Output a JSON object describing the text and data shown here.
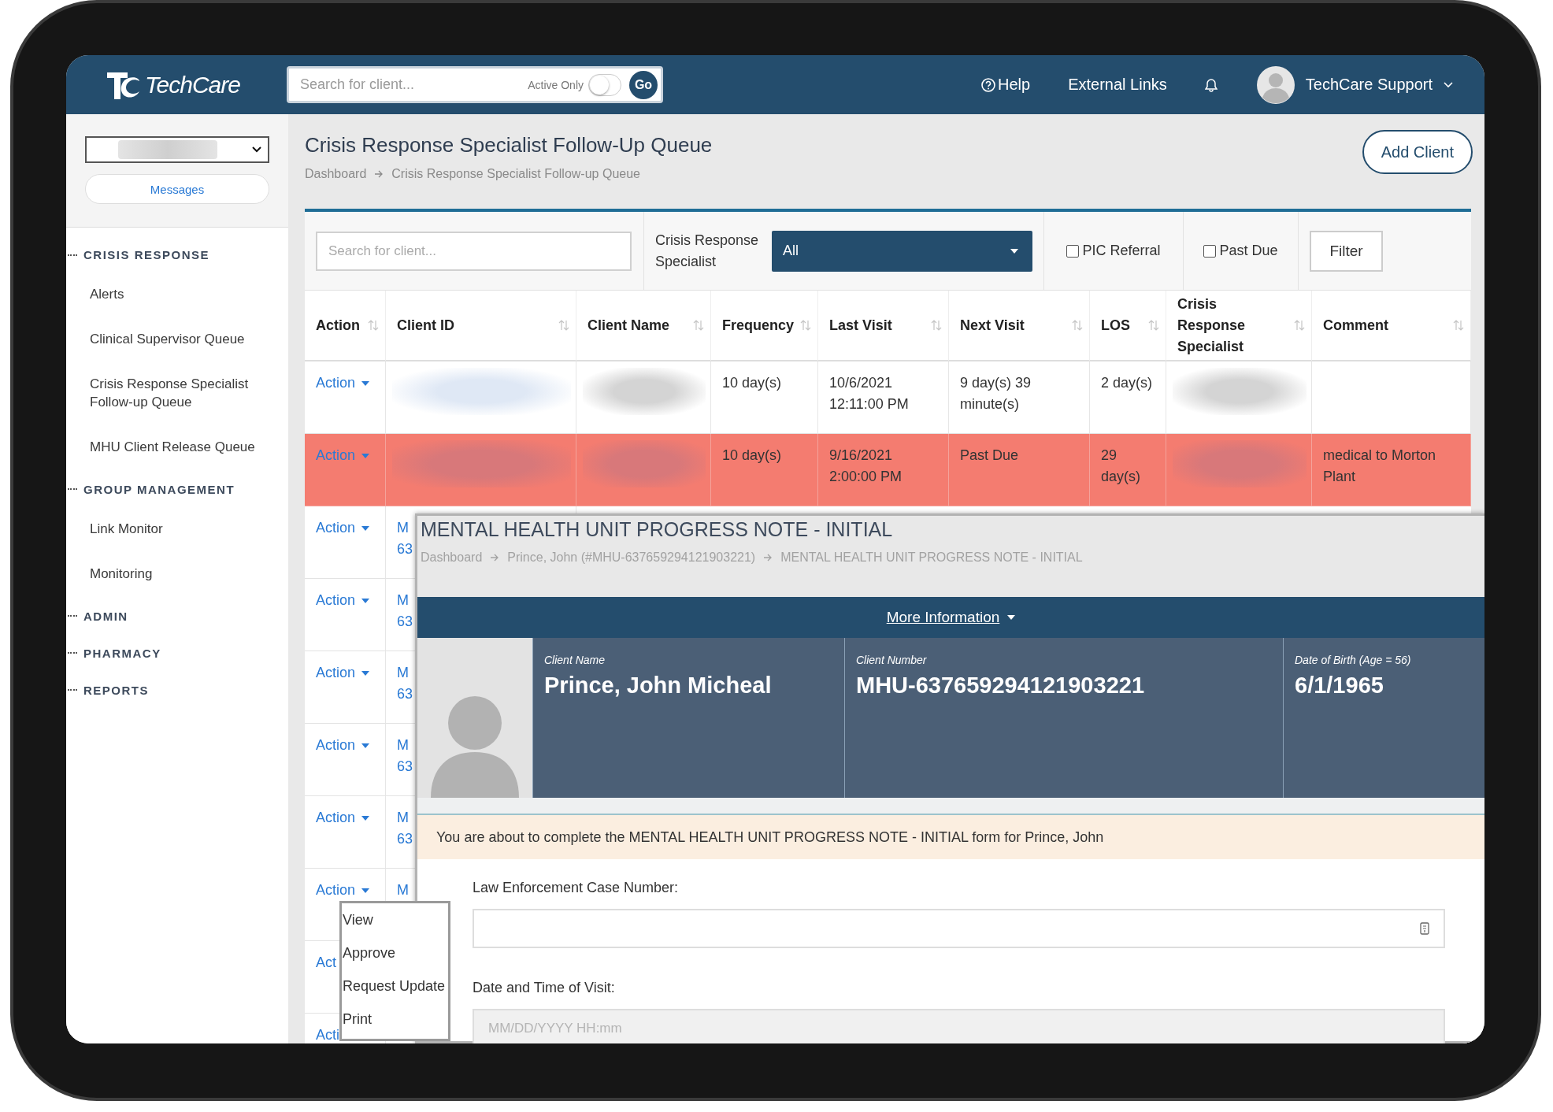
{
  "header": {
    "brand": "TechCare",
    "search": {
      "placeholder": "Search for client...",
      "toggle_label": "Active Only",
      "active_only": false,
      "go": "Go"
    },
    "help": "Help",
    "external_links": "External Links",
    "user": "TechCare Support"
  },
  "sidebar": {
    "site_select": {
      "redacted": true
    },
    "messages": "Messages",
    "sections": [
      {
        "title": "CRISIS RESPONSE",
        "items": [
          "Alerts",
          "Clinical Supervisor Queue",
          "Crisis Response Specialist Follow-up Queue",
          "MHU Client Release Queue"
        ]
      },
      {
        "title": "GROUP MANAGEMENT",
        "items": [
          "Link Monitor",
          "Monitoring"
        ]
      },
      {
        "title": "ADMIN"
      },
      {
        "title": "PHARMACY"
      },
      {
        "title": "REPORTS"
      }
    ]
  },
  "page": {
    "title": "Crisis Response Specialist Follow-Up Queue",
    "breadcrumb": [
      "Dashboard",
      "Crisis Response Specialist Follow-up Queue"
    ],
    "add_client": "Add Client"
  },
  "filters": {
    "search_placeholder": "Search for client...",
    "specialist_label": "Crisis Response Specialist",
    "specialist_value": "All",
    "checkboxes": [
      {
        "label": "PIC Referral",
        "checked": false
      },
      {
        "label": "Past Due",
        "checked": false
      }
    ],
    "filter_button": "Filter"
  },
  "table": {
    "columns": [
      {
        "label": "Action",
        "sortable": true
      },
      {
        "label": "Client ID",
        "sortable": true
      },
      {
        "label": "Client Name",
        "sortable": true
      },
      {
        "label": "Frequency",
        "sortable": true
      },
      {
        "label": "Last Visit",
        "sortable": true
      },
      {
        "label": "Next Visit",
        "sortable": true
      },
      {
        "label": "LOS",
        "sortable": true
      },
      {
        "label": "Crisis Response Specialist",
        "sortable": true
      },
      {
        "label": "Comment",
        "sortable": true
      }
    ],
    "rows": [
      {
        "action": "Action",
        "caret": true,
        "redacted": true,
        "past_due": false,
        "frequency": "10 day(s)",
        "last_visit": [
          "10/6/2021",
          "12:11:00 PM"
        ],
        "next_visit": [
          "9 day(s) 39",
          "minute(s)"
        ],
        "los": [
          "2 day(s)"
        ]
      },
      {
        "action": "Action",
        "caret": true,
        "redacted": true,
        "past_due": true,
        "frequency": "10 day(s)",
        "last_visit": [
          "9/16/2021",
          "2:00:00 PM"
        ],
        "next_visit": [
          "Past Due"
        ],
        "los": [
          "29",
          "day(s)"
        ],
        "comment": [
          "medical to Morton",
          "Plant"
        ]
      },
      {
        "action": "Action",
        "caret": true,
        "past_due": false,
        "client_id": [
          "M",
          "63"
        ]
      },
      {
        "action": "Action",
        "caret": true,
        "past_due": false,
        "client_id": [
          "M",
          "63"
        ]
      },
      {
        "action": "Action",
        "caret": true,
        "past_due": false,
        "client_id": [
          "M",
          "63"
        ]
      },
      {
        "action": "Action",
        "caret": true,
        "past_due": false,
        "client_id": [
          "M",
          "63"
        ]
      },
      {
        "action": "Action",
        "caret": true,
        "past_due": false,
        "client_id": [
          "M",
          "63"
        ]
      },
      {
        "action": "Action",
        "caret": true,
        "past_due": false,
        "client_id": [
          "M"
        ]
      },
      {
        "action": "Act",
        "caret": false,
        "past_due": false
      },
      {
        "action": "Acti",
        "caret": false,
        "past_due": false
      }
    ]
  },
  "action_menu": [
    "View",
    "Approve",
    "Request Update",
    "Print"
  ],
  "progress_note": {
    "title": "MENTAL HEALTH UNIT PROGRESS NOTE - INITIAL",
    "breadcrumb": [
      "Dashboard",
      "Prince, John (#MHU-637659294121903221)",
      "MENTAL HEALTH UNIT PROGRESS NOTE - INITIAL"
    ],
    "more_info": "More Information",
    "client_fields": [
      {
        "label": "Client Name",
        "value": "Prince, John Micheal"
      },
      {
        "label": "Client Number",
        "value": "MHU-637659294121903221"
      },
      {
        "label": "Date of Birth (Age = 56)",
        "value": "6/1/1965"
      }
    ],
    "notice": "You are about to complete the MENTAL HEALTH UNIT PROGRESS NOTE - INITIAL form for Prince, John",
    "fields": [
      {
        "label": "Law Enforcement Case Number:",
        "kind": "text",
        "disabled": false
      },
      {
        "label": "Date and Time of Visit:",
        "kind": "datetime",
        "placeholder": "MM/DD/YYYY HH:mm",
        "disabled": true
      }
    ]
  }
}
